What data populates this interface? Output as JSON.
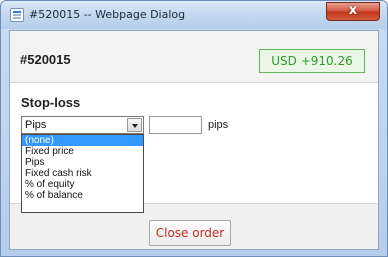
{
  "window": {
    "title": "#520015 -- Webpage Dialog",
    "close_glyph": "x"
  },
  "header": {
    "order_id": "#520015",
    "pnl": "USD +910.26",
    "pnl_color": "#2f9a2b"
  },
  "stop_loss": {
    "label": "Stop-loss",
    "selected": "Pips",
    "value": "",
    "unit": "pips",
    "options": [
      "(none)",
      "Fixed price",
      "Pips",
      "Fixed cash risk",
      "% of equity",
      "% of balance"
    ],
    "highlighted_option": "(none)"
  },
  "footer": {
    "close_order_label": "Close order",
    "close_order_color": "#c62b1f"
  }
}
